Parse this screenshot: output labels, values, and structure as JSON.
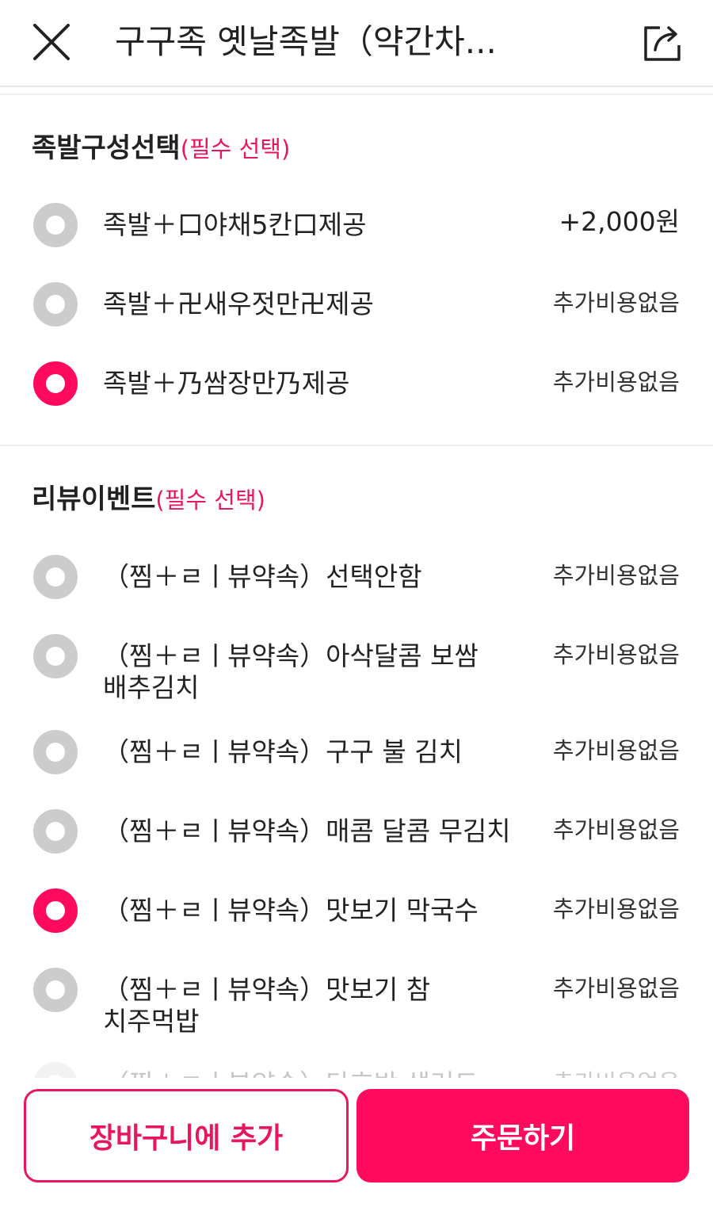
{
  "header": {
    "title": "구구족 옛날족발（약간차...",
    "close_icon": "close-icon",
    "share_icon": "share-icon"
  },
  "sections": [
    {
      "title": "족발구성선택",
      "required": "(필수 선택)",
      "options": [
        {
          "label": "족발＋口야채5칸口제공",
          "price": "+2,000원",
          "selected": false
        },
        {
          "label": "족발＋卍새우젓만卍제공",
          "price": "추가비용없음",
          "selected": false
        },
        {
          "label": "족발＋乃쌈장만乃제공",
          "price": "추가비용없음",
          "selected": true
        }
      ]
    },
    {
      "title": "리뷰이벤트",
      "required": "(필수 선택)",
      "options": [
        {
          "label": "（찜＋ㄹㅣ뷰약속）선택안함",
          "price": "추가비용없음",
          "selected": false
        },
        {
          "label": "（찜＋ㄹㅣ뷰약속）아삭달콤 보쌈배추김치",
          "price": "추가비용없음",
          "selected": false
        },
        {
          "label": "（찜＋ㄹㅣ뷰약속）구구 불 김치",
          "price": "추가비용없음",
          "selected": false
        },
        {
          "label": "（찜＋ㄹㅣ뷰약속）매콤 달콤 무김치",
          "price": "추가비용없음",
          "selected": false
        },
        {
          "label": "（찜＋ㄹㅣ뷰약속）맛보기 막국수",
          "price": "추가비용없음",
          "selected": true
        },
        {
          "label": "（찜＋ㄹㅣ뷰약속）맛보기 참치주먹밥",
          "price": "추가비용없음",
          "selected": false
        },
        {
          "label": "（찜＋ㄹㅣ뷰약속）단호박 샐러드",
          "price": "추가비용없음",
          "selected": false
        }
      ]
    }
  ],
  "bottom": {
    "cart_label": "장바구니에 추가",
    "order_label": "주문하기"
  },
  "colors": {
    "accent": "#ff0a5c",
    "required_text": "#e8175d",
    "radio_off": "#cccccc"
  }
}
